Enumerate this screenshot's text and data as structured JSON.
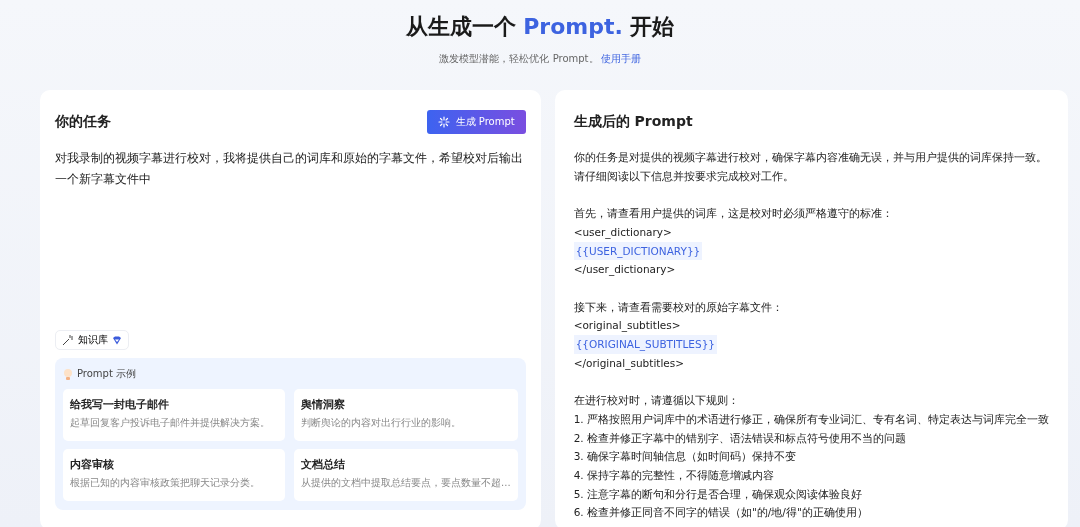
{
  "header": {
    "title_lead": "从生成一个",
    "title_accent": "Prompt.",
    "title_tail": "开始",
    "subtitle": "激发模型潜能，轻松优化 Prompt。",
    "manual_link": "使用手册"
  },
  "task_panel": {
    "title": "你的任务",
    "generate_button": "生成 Prompt",
    "task_text": "对我录制的视频字幕进行校对，我将提供自己的词库和原始的字幕文件，希望校对后输出一个新字幕文件中",
    "knowledge_base": "知识库",
    "examples": {
      "title": "Prompt 示例",
      "items": [
        {
          "title": "给我写一封电子邮件",
          "description": "起草回复客户投诉电子邮件并提供解决方案。"
        },
        {
          "title": "舆情洞察",
          "description": "判断舆论的内容对出行行业的影响。"
        },
        {
          "title": "内容审核",
          "description": "根据已知的内容审核政策把聊天记录分类。"
        },
        {
          "title": "文档总结",
          "description": "从提供的文档中提取总结要点，要点数量不超..."
        }
      ]
    }
  },
  "result_panel": {
    "title": "生成后的 Prompt",
    "paragraphs": [
      [
        {
          "kind": "text",
          "text": "你的任务是对提供的视频字幕进行校对，确保字幕内容准确无误，并与用户提供的词库保持一致。"
        },
        {
          "kind": "text",
          "text": "请仔细阅读以下信息并按要求完成校对工作。"
        }
      ],
      [
        {
          "kind": "text",
          "text": "首先，请查看用户提供的词库，这是校对时必须严格遵守的标准："
        },
        {
          "kind": "text",
          "text": "<user_dictionary>"
        },
        {
          "kind": "variable",
          "text": "{{USER_DICTIONARY}}"
        },
        {
          "kind": "text",
          "text": "</user_dictionary>"
        }
      ],
      [
        {
          "kind": "text",
          "text": "接下来，请查看需要校对的原始字幕文件："
        },
        {
          "kind": "text",
          "text": "<original_subtitles>"
        },
        {
          "kind": "variable",
          "text": "{{ORIGINAL_SUBTITLES}}"
        },
        {
          "kind": "text",
          "text": "</original_subtitles>"
        }
      ],
      [
        {
          "kind": "text",
          "text": "在进行校对时，请遵循以下规则："
        },
        {
          "kind": "text",
          "text": "1. 严格按照用户词库中的术语进行修正，确保所有专业词汇、专有名词、特定表达与词库完全一致"
        },
        {
          "kind": "text",
          "text": "2. 检查并修正字幕中的错别字、语法错误和标点符号使用不当的问题"
        },
        {
          "kind": "text",
          "text": "3. 确保字幕时间轴信息（如时间码）保持不变"
        },
        {
          "kind": "text",
          "text": "4. 保持字幕的完整性，不得随意增减内容"
        },
        {
          "kind": "text",
          "text": "5. 注意字幕的断句和分行是否合理，确保观众阅读体验良好"
        },
        {
          "kind": "text",
          "text": "6. 检查并修正同音不同字的错误（如\"的/地/得\"的正确使用）"
        }
      ]
    ]
  }
}
